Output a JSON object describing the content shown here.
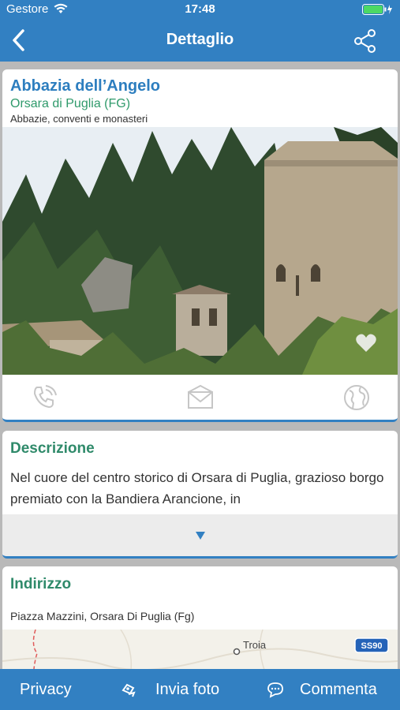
{
  "status": {
    "carrier": "Gestore",
    "time": "17:48"
  },
  "nav": {
    "title": "Dettaglio"
  },
  "poi": {
    "name": "Abbazia dell’Angelo",
    "location": "Orsara di Puglia (FG)",
    "category": "Abbazie, conventi e monasteri"
  },
  "actions": [
    "phone-icon",
    "mail-icon",
    "globe-icon"
  ],
  "description": {
    "heading": "Descrizione",
    "text": "Nel cuore del centro storico di Orsara di Puglia, grazioso borgo premiato con la Bandiera Arancione, in"
  },
  "address": {
    "heading": "Indirizzo",
    "value": "Piazza Mazzini, Orsara Di Puglia (Fg)",
    "map_place": "Troia",
    "map_road": "SS90"
  },
  "bottom": {
    "privacy": "Privacy",
    "send_photo": "Invia foto",
    "comment": "Commenta"
  },
  "colors": {
    "primary": "#3280c2",
    "title": "#2d7ebf",
    "accent_green": "#2f8a6a"
  }
}
